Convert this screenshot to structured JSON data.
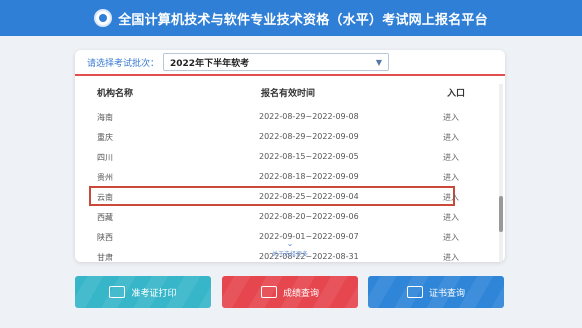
{
  "header": {
    "title": "全国计算机技术与软件专业技术资格（水平）考试网上报名平台"
  },
  "batch": {
    "label": "请选择考试批次：",
    "selected": "2022年下半年软考"
  },
  "table": {
    "columns": [
      "机构名称",
      "报名有效时间",
      "入口"
    ],
    "rows": [
      {
        "region": "海南",
        "period": "2022-08-29~2022-09-08",
        "entry": "进入"
      },
      {
        "region": "重庆",
        "period": "2022-08-29~2022-09-09",
        "entry": "进入"
      },
      {
        "region": "四川",
        "period": "2022-08-15~2022-09-05",
        "entry": "进入"
      },
      {
        "region": "贵州",
        "period": "2022-08-18~2022-09-09",
        "entry": "进入"
      },
      {
        "region": "云南",
        "period": "2022-08-25~2022-09-04",
        "entry": "进入"
      },
      {
        "region": "西藏",
        "period": "2022-08-20~2022-09-06",
        "entry": "进入"
      },
      {
        "region": "陕西",
        "period": "2022-09-01~2022-09-07",
        "entry": "进入"
      },
      {
        "region": "甘肃",
        "period": "2022-08-22~2022-08-31",
        "entry": "进入"
      }
    ],
    "more_text": "关于选择更多"
  },
  "buttons": [
    {
      "label": "准考证打印",
      "icon": "id-card-icon"
    },
    {
      "label": "成绩查询",
      "icon": "document-icon"
    },
    {
      "label": "证书查询",
      "icon": "certificate-icon"
    }
  ],
  "colors": {
    "header": "#2f7fd6",
    "highlight": "#c94a3a",
    "btn_admission": "#37b6c9",
    "btn_score": "#e6474f",
    "btn_certificate": "#2f86d8"
  }
}
